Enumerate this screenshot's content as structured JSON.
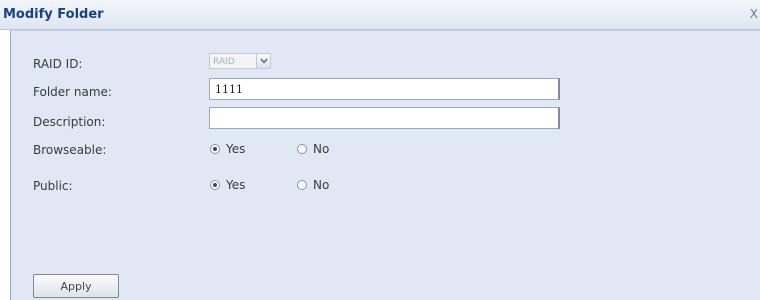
{
  "dialog": {
    "title": "Modify Folder",
    "close_glyph": "X"
  },
  "form": {
    "raid_id": {
      "label": "RAID ID:",
      "selected": "RAID"
    },
    "folder_name": {
      "label": "Folder name:",
      "value": "1111"
    },
    "description": {
      "label": "Description:",
      "value": ""
    },
    "browseable": {
      "label": "Browseable:",
      "options": [
        "Yes",
        "No"
      ],
      "selected": "Yes"
    },
    "public": {
      "label": "Public:",
      "options": [
        "Yes",
        "No"
      ],
      "selected": "Yes"
    }
  },
  "actions": {
    "apply_label": "Apply"
  },
  "icons": {
    "dropdown": "chevron-down-icon",
    "close": "close-icon"
  },
  "colors": {
    "title_text": "#15428b",
    "form_background": "#e0e8f6",
    "titlebar_background": "#dfe6f1"
  }
}
